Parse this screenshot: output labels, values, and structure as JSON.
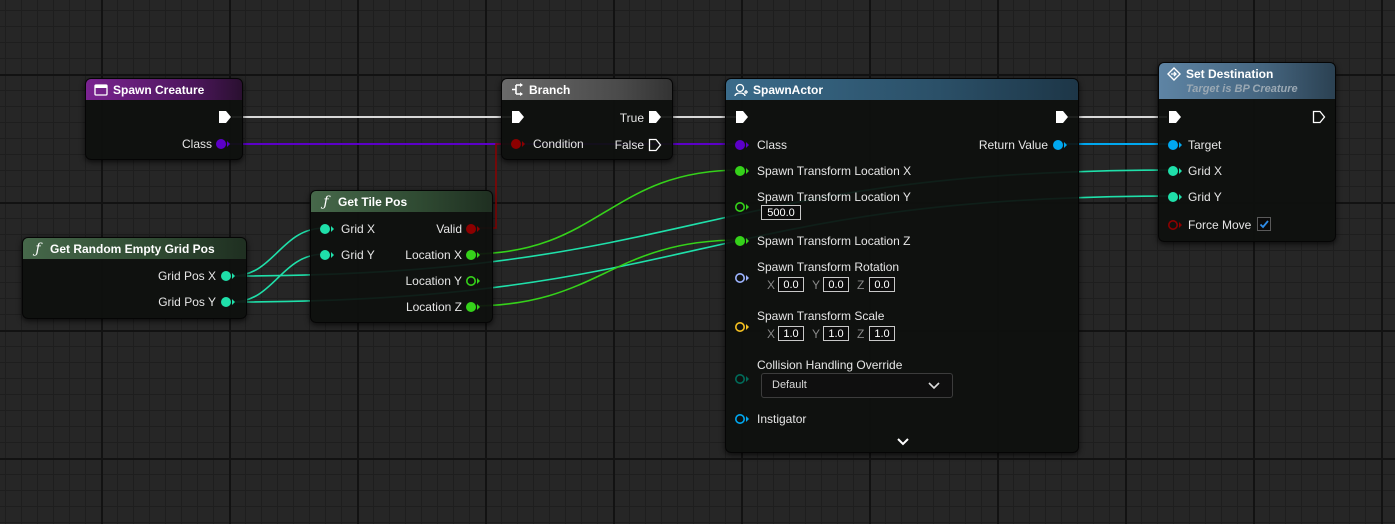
{
  "nodes": {
    "spawn_creature": {
      "title": "Spawn Creature",
      "pins": {
        "class": "Class"
      }
    },
    "branch": {
      "title": "Branch",
      "pins": {
        "condition": "Condition",
        "true": "True",
        "false": "False"
      }
    },
    "spawn_actor": {
      "title": "SpawnActor",
      "pins": {
        "class": "Class",
        "loc_x": "Spawn Transform Location X",
        "loc_y": "Spawn Transform Location Y",
        "loc_y_value": "500.0",
        "loc_z": "Spawn Transform Location Z",
        "rotation": "Spawn Transform Rotation",
        "rotation_values": {
          "x": "0.0",
          "y": "0.0",
          "z": "0.0"
        },
        "scale": "Spawn Transform Scale",
        "scale_values": {
          "x": "1.0",
          "y": "1.0",
          "z": "1.0"
        },
        "collision": "Collision Handling Override",
        "collision_value": "Default",
        "instigator": "Instigator",
        "return_value": "Return Value"
      },
      "axis_labels": {
        "x": "X",
        "y": "Y",
        "z": "Z"
      }
    },
    "set_destination": {
      "title": "Set Destination",
      "subtitle": "Target is BP Creature",
      "pins": {
        "target": "Target",
        "grid_x": "Grid X",
        "grid_y": "Grid Y",
        "force_move": "Force Move"
      },
      "force_move_checked": true
    },
    "get_tile_pos": {
      "title": "Get Tile Pos",
      "pins": {
        "grid_x": "Grid X",
        "grid_y": "Grid Y",
        "valid": "Valid",
        "loc_x": "Location X",
        "loc_y": "Location Y",
        "loc_z": "Location Z"
      }
    },
    "get_random_grid": {
      "title": "Get Random Empty Grid Pos",
      "pins": {
        "grid_pos_x": "Grid Pos X",
        "grid_pos_y": "Grid Pos Y"
      }
    }
  },
  "colors": {
    "exec": "#ffffff",
    "class": "#5c00c8",
    "bool": "#8c0000",
    "int": "#1fe0aa",
    "float": "#35d21a",
    "object": "#00a8f0",
    "rotator": "#9db4ff",
    "vector": "#f5c121",
    "enum": "#006b5a",
    "header_event": "#6e1f82",
    "header_function": "#3c5a3c",
    "header_spawn": "#3a6b8a",
    "header_set_dest": "#5a7d9a",
    "header_branch": "#555555"
  },
  "icons": {
    "spawn_creature": "event-icon",
    "branch": "branch-icon",
    "spawn_actor": "spawn-actor-icon",
    "set_destination": "function-call-icon",
    "get_tile_pos": "function-icon",
    "get_random_grid": "function-icon"
  }
}
